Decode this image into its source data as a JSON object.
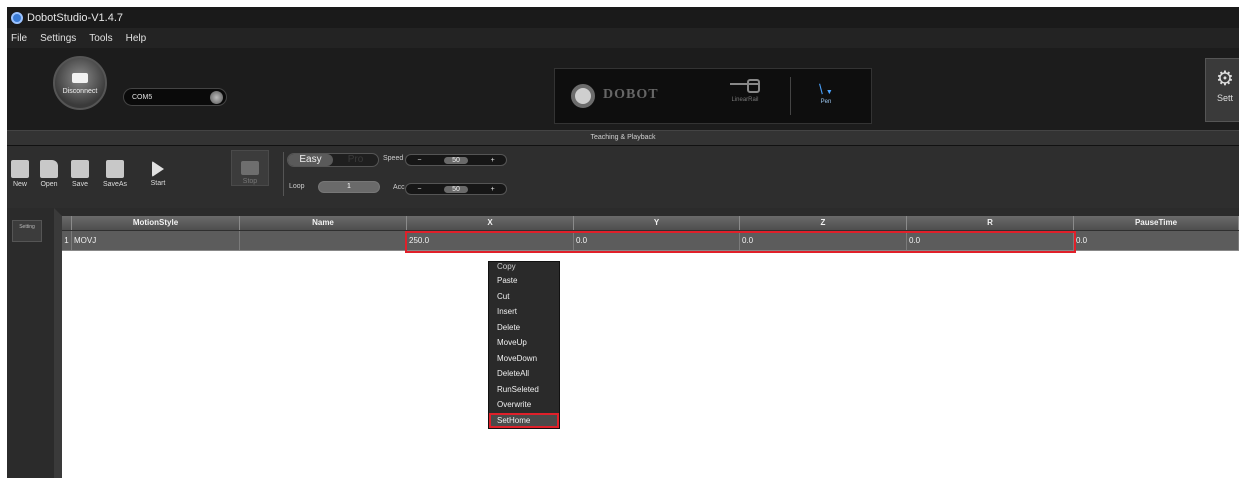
{
  "window": {
    "title": "DobotStudio-V1.4.7"
  },
  "menu": [
    "File",
    "Settings",
    "Tools",
    "Help"
  ],
  "header": {
    "connect_label": "Disconnect",
    "port_value": "COM5",
    "brand": "DOBOT",
    "rail_label": "LinearRail",
    "tool_label": "Pen",
    "settings_label": "Sett"
  },
  "section_title": "Teaching & Playback",
  "toolbar": {
    "new": "New",
    "open": "Open",
    "save": "Save",
    "saveas": "SaveAs",
    "start": "Start",
    "stop": "Stop",
    "mode_easy": "Easy",
    "mode_pro": "Pro",
    "loop_label": "Loop",
    "loop_value": "1",
    "speed_label": "Speed",
    "speed_value": "50",
    "acc_label": "Acc",
    "acc_value": "50",
    "minus": "−",
    "plus": "+"
  },
  "side_button": "Setting",
  "table": {
    "columns": [
      "MotionStyle",
      "Name",
      "X",
      "Y",
      "Z",
      "R",
      "PauseTime"
    ],
    "rows": [
      {
        "index": "1",
        "motion_style": "MOVJ",
        "name": "",
        "x": "250.0",
        "y": "0.0",
        "z": "0.0",
        "r": "0.0",
        "pause_time": "0.0"
      }
    ]
  },
  "context_menu": [
    "Copy",
    "Paste",
    "Cut",
    "Insert",
    "Delete",
    "MoveUp",
    "MoveDown",
    "DeleteAll",
    "RunSeleted",
    "Overwrite",
    "SetHome"
  ],
  "colors": {
    "highlight_red": "#e0202a",
    "accent_blue": "#4aa3ff"
  }
}
